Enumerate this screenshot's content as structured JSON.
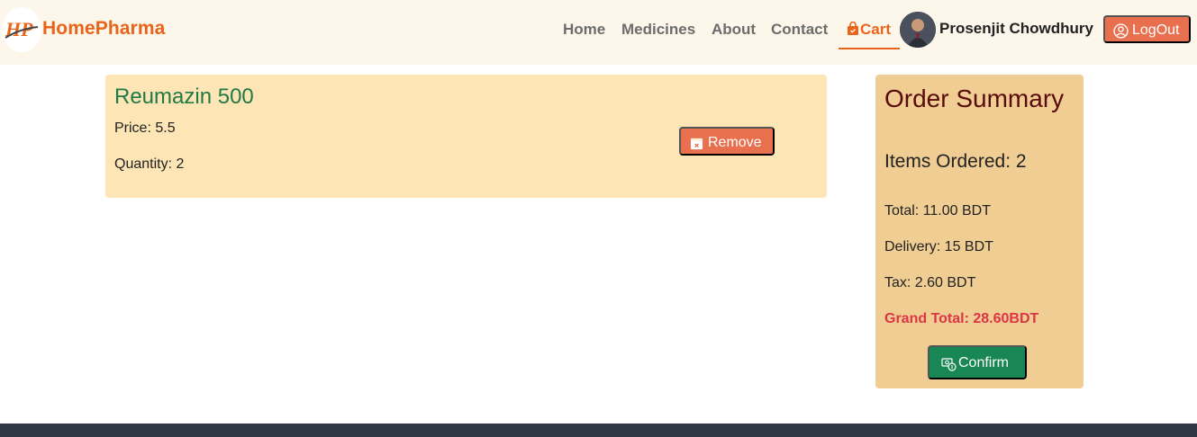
{
  "brand": {
    "name": "HomePharma",
    "logo_initials": "HP"
  },
  "nav": {
    "links": [
      "Home",
      "Medicines",
      "About",
      "Contact"
    ],
    "cart_label": "Cart",
    "user_name": "Prosenjit Chowdhury",
    "logout_label": "LogOut"
  },
  "cart_item": {
    "name": "Reumazin 500",
    "price": "Price: 5.5",
    "quantity": "Quantity: 2",
    "remove_label": "Remove"
  },
  "summary": {
    "title": "Order Summary",
    "items_ordered": "Items Ordered: 2",
    "total": "Total: 11.00 BDT",
    "delivery": "Delivery: 15 BDT",
    "tax": "Tax: 2.60 BDT",
    "grand_total": "Grand Total: 28.60BDT",
    "confirm_label": "Confirm"
  },
  "colors": {
    "accent": "#e8641b",
    "button": "#e8704f",
    "item_bg": "#fde5b6",
    "summary_bg": "#f0cd92",
    "confirm": "#198754",
    "grand_total": "#dc3545",
    "footer": "#2f3744"
  },
  "icons": [
    "brand-logo-icon",
    "cart-bag-icon",
    "user-circle-icon",
    "calendar-x-icon",
    "cash-coin-icon"
  ]
}
